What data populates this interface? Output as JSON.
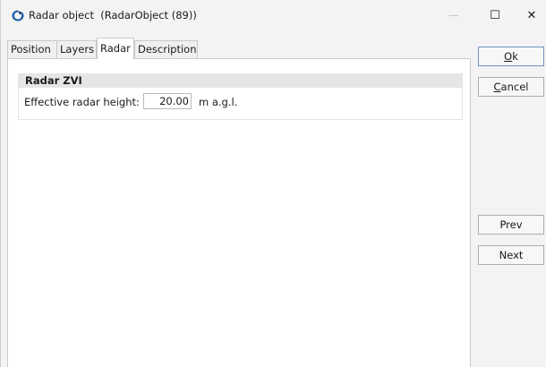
{
  "window": {
    "title": "Radar object  (RadarObject (89))",
    "icon": "radar-globe-icon",
    "controls": {
      "minimize": "—",
      "maximize": "☐",
      "close": "✕"
    }
  },
  "tabs": [
    {
      "label": "Position",
      "active": false
    },
    {
      "label": "Layers",
      "active": false
    },
    {
      "label": "Radar",
      "active": true
    },
    {
      "label": "Description",
      "active": false
    }
  ],
  "radar_panel": {
    "group_title": "Radar ZVI",
    "field_label": "Effective radar height:",
    "field_value": "20.00",
    "field_unit": "m a.g.l."
  },
  "buttons": {
    "ok_mnemonic": "O",
    "ok_rest": "k",
    "cancel_mnemonic": "C",
    "cancel_rest": "ancel",
    "prev": "Prev",
    "next": "Next"
  },
  "colors": {
    "accent_border": "#6d8fc4",
    "icon_blue": "#1f5fa8"
  }
}
